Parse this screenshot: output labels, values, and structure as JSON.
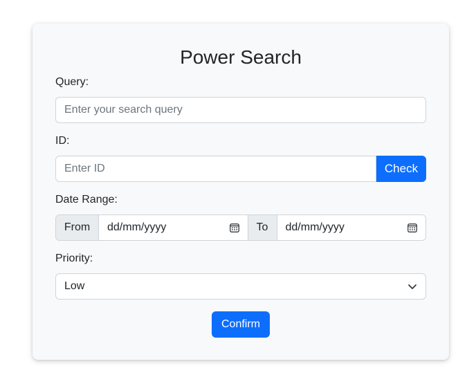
{
  "form": {
    "title": "Power Search",
    "query": {
      "label": "Query:",
      "placeholder": "Enter your search query"
    },
    "id": {
      "label": "ID:",
      "placeholder": "Enter ID",
      "button": "Check"
    },
    "date_range": {
      "label": "Date Range:",
      "from_label": "From",
      "from_value": "dd/mm/yyyy",
      "to_label": "To",
      "to_value": "dd/mm/yyyy",
      "calendar_icon": "calendar-icon"
    },
    "priority": {
      "label": "Priority:",
      "selected": "Low",
      "chevron_icon": "chevron-down-icon"
    },
    "confirm": "Confirm"
  },
  "colors": {
    "primary": "#0d6efd",
    "card_bg": "#f8f9fa",
    "border": "#ced4da",
    "addon_bg": "#e9ecef",
    "placeholder": "#6c757d"
  }
}
